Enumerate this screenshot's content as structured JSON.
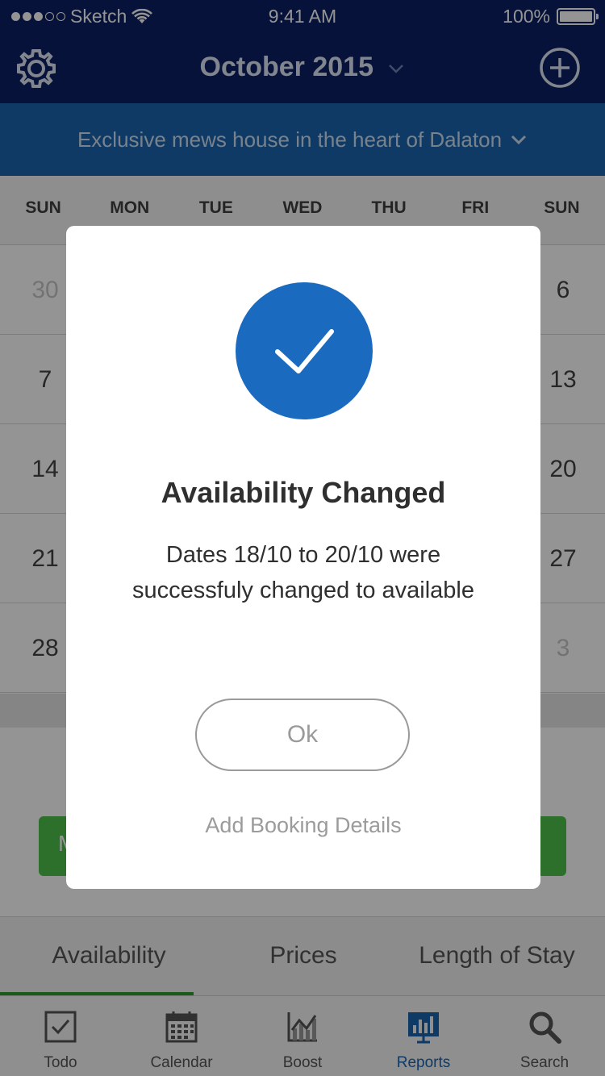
{
  "status_bar": {
    "carrier": "Sketch",
    "time": "9:41 AM",
    "battery": "100%"
  },
  "nav": {
    "title": "October 2015",
    "left_icon": "gear-icon",
    "right_icon": "plus-circle-icon"
  },
  "property": {
    "name": "Exclusive mews house in the heart of Dalaton"
  },
  "calendar": {
    "weekdays": [
      "SUN",
      "MON",
      "TUE",
      "WED",
      "THU",
      "FRI",
      "SUN"
    ],
    "rows": [
      {
        "left": "30",
        "right": "6",
        "left_muted": true,
        "right_muted": false
      },
      {
        "left": "7",
        "right": "13",
        "left_muted": false,
        "right_muted": false
      },
      {
        "left": "14",
        "right": "20",
        "left_muted": false,
        "right_muted": false
      },
      {
        "left": "21",
        "right": "27",
        "left_muted": false,
        "right_muted": false
      },
      {
        "left": "28",
        "right": "3",
        "left_muted": false,
        "right_muted": true
      }
    ]
  },
  "action_button": {
    "label": "M",
    "color": "#4cc24a"
  },
  "segment_tabs": [
    {
      "label": "Availability",
      "active": true
    },
    {
      "label": "Prices",
      "active": false
    },
    {
      "label": "Length of Stay",
      "active": false
    }
  ],
  "tab_bar": [
    {
      "label": "Todo",
      "icon": "checkbox-icon",
      "active": false
    },
    {
      "label": "Calendar",
      "icon": "calendar-icon",
      "active": false
    },
    {
      "label": "Boost",
      "icon": "line-chart-icon",
      "active": false
    },
    {
      "label": "Reports",
      "icon": "bar-chart-icon",
      "active": true
    },
    {
      "label": "Search",
      "icon": "search-icon",
      "active": false
    }
  ],
  "modal": {
    "icon": "checkmark-icon",
    "title": "Availability Changed",
    "message": "Dates 18/10 to 20/10 were successfuly changed to available",
    "ok_label": "Ok",
    "secondary_link": "Add Booking Details"
  },
  "colors": {
    "nav_bg": "#0b1f63",
    "property_bar_bg": "#1a65b0",
    "accent": "#1a6bbf",
    "active_tab": "#1a65b0"
  }
}
